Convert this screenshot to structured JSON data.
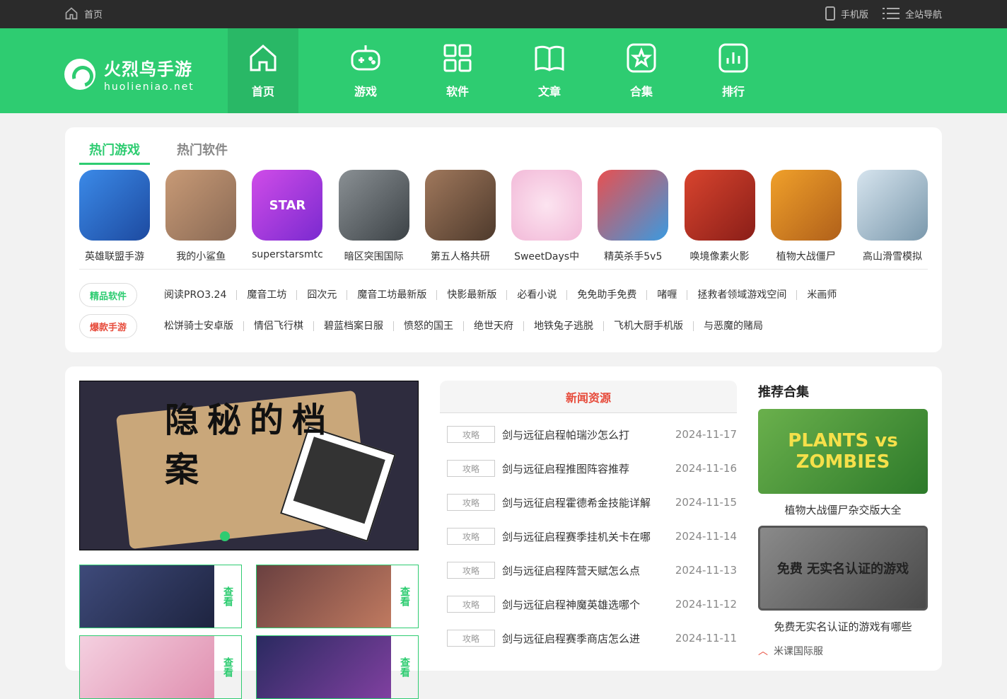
{
  "topbar": {
    "home": "首页",
    "mobile": "手机版",
    "sitenav": "全站导航"
  },
  "logo": {
    "name": "火烈鸟手游",
    "domain": "huolieniao.net"
  },
  "nav": [
    {
      "label": "首页",
      "icon": "home-icon"
    },
    {
      "label": "游戏",
      "icon": "gamepad-icon"
    },
    {
      "label": "软件",
      "icon": "grid-icon"
    },
    {
      "label": "文章",
      "icon": "book-icon"
    },
    {
      "label": "合集",
      "icon": "star-icon"
    },
    {
      "label": "排行",
      "icon": "chart-icon"
    }
  ],
  "hot": {
    "tabs": [
      "热门游戏",
      "热门软件"
    ],
    "games": [
      {
        "name": "英雄联盟手游",
        "color": "#2d6fd6"
      },
      {
        "name": "我的小鲨鱼",
        "color": "#b98a6a"
      },
      {
        "name": "superstarsmtc",
        "color": "#a63ce0"
      },
      {
        "name": "暗区突围国际",
        "color": "#5e6468"
      },
      {
        "name": "第五人格共研",
        "color": "#7a5a44"
      },
      {
        "name": "SweetDays中",
        "color": "#f7c9e0"
      },
      {
        "name": "精英杀手5v5",
        "color": "#e24b4b"
      },
      {
        "name": "唤境像素火影",
        "color": "#c7382e"
      },
      {
        "name": "植物大战僵尸",
        "color": "#d9811f"
      },
      {
        "name": "高山滑雪模拟",
        "color": "#9bb7c9"
      }
    ],
    "rows": [
      {
        "tag": "精品软件",
        "color": "#2ecc71",
        "links": [
          "阅读PRO3.24",
          "魔音工坊",
          "囧次元",
          "魔音工坊最新版",
          "快影最新版",
          "必看小说",
          "免免助手免费",
          "啫喱",
          "拯救者领域游戏空间",
          "米画师"
        ]
      },
      {
        "tag": "爆款手游",
        "color": "#e74c3c",
        "links": [
          "松饼骑士安卓版",
          "情侣飞行棋",
          "碧蓝档案日服",
          "愤怒的国王",
          "绝世天府",
          "地铁兔子逃脱",
          "飞机大厨手机版",
          "与恶魔的赌局"
        ]
      }
    ]
  },
  "banner": {
    "text": "隐秘的档案"
  },
  "thumbs": [
    {
      "cta": "查看",
      "color": "#36416b"
    },
    {
      "cta": "查看",
      "color": "#5a3a3a"
    },
    {
      "cta": "查看",
      "color": "#f0c8d8"
    },
    {
      "cta": "查看",
      "color": "#2a2a5a"
    }
  ],
  "news": {
    "title": "新闻资源",
    "items": [
      {
        "badge": "攻略",
        "title": "剑与远征启程帕瑞沙怎么打",
        "date": "2024-11-17"
      },
      {
        "badge": "攻略",
        "title": "剑与远征启程推图阵容推荐",
        "date": "2024-11-16"
      },
      {
        "badge": "攻略",
        "title": "剑与远征启程霍德希金技能详解",
        "date": "2024-11-15"
      },
      {
        "badge": "攻略",
        "title": "剑与远征启程赛季挂机关卡在哪",
        "date": "2024-11-14"
      },
      {
        "badge": "攻略",
        "title": "剑与远征启程阵营天赋怎么点",
        "date": "2024-11-13"
      },
      {
        "badge": "攻略",
        "title": "剑与远征启程神魔英雄选哪个",
        "date": "2024-11-12"
      },
      {
        "badge": "攻略",
        "title": "剑与远征启程赛季商店怎么进",
        "date": "2024-11-11"
      }
    ]
  },
  "recommend": {
    "title": "推荐合集",
    "items": [
      {
        "caption": "植物大战僵尸杂交版大全",
        "img_text": "PLANTS vs ZOMBIES"
      },
      {
        "caption": "免费无实名认证的游戏有哪些",
        "img_text": "免费 无实名认证的游戏"
      }
    ],
    "more": "米课国际服"
  }
}
